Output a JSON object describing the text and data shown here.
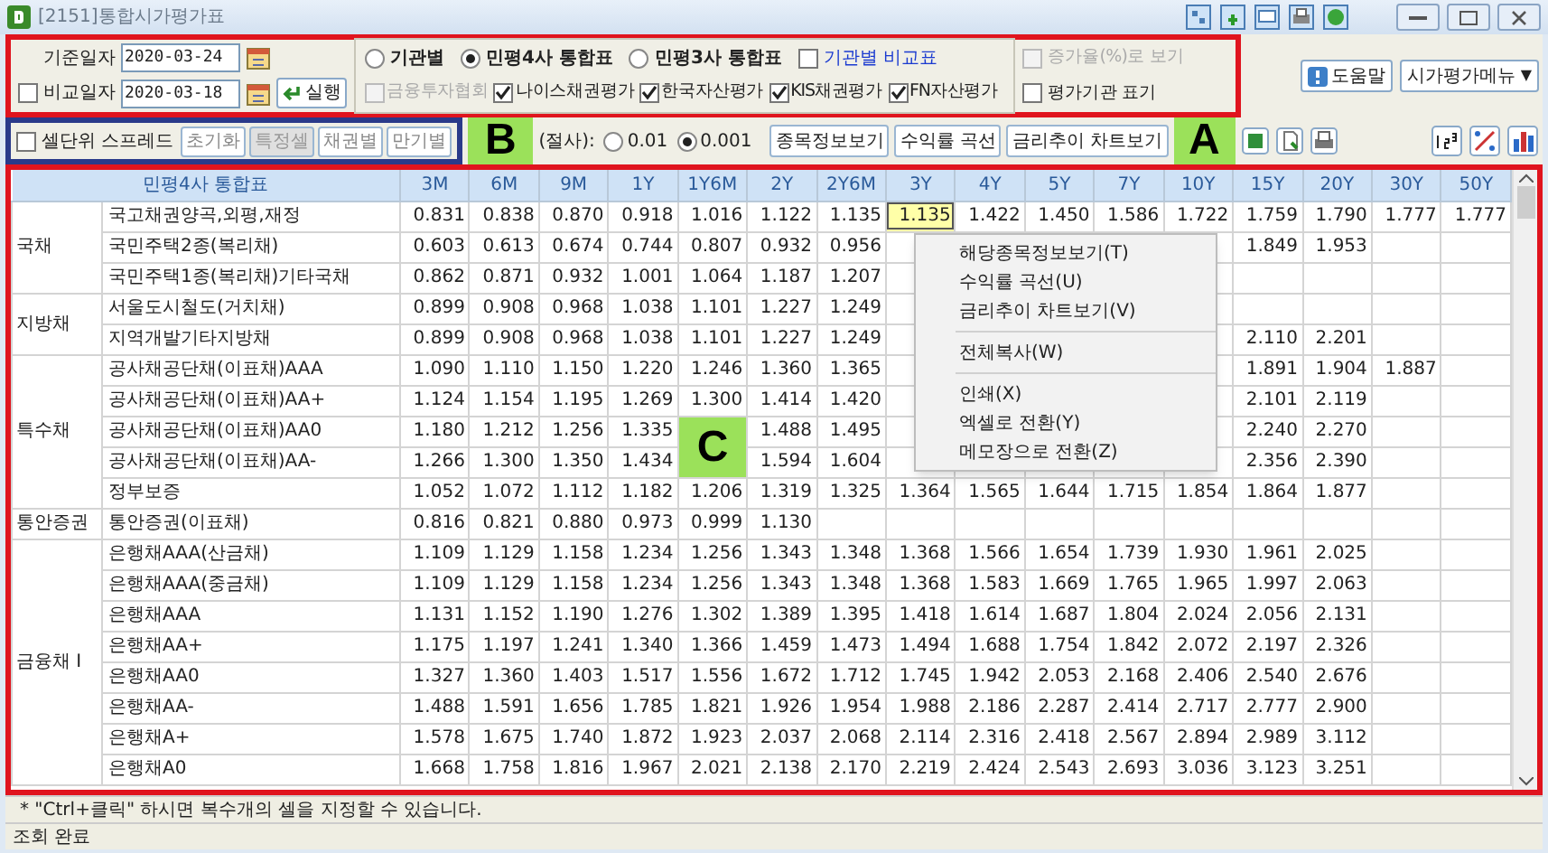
{
  "title_bar": {
    "title": "[2151]통합시가평가표"
  },
  "dates": [
    {
      "kind": "plain",
      "label": "기준일자",
      "value": "2020-03-24"
    },
    {
      "kind": "checkbox",
      "label": "비교일자",
      "value": "2020-03-18",
      "checked": false
    }
  ],
  "run_button": "실행",
  "view_radios": [
    {
      "label": "기관별",
      "selected": false
    },
    {
      "label": "민평4사 통합표",
      "selected": true
    },
    {
      "label": "민평3사 통합표",
      "selected": false
    }
  ],
  "compare_checkbox": {
    "label": "기관별 비교표",
    "checked": false
  },
  "agencies": [
    {
      "label": "금융투자협회",
      "checked": false,
      "disabled": true
    },
    {
      "label": "나이스채권평가",
      "checked": true,
      "disabled": false
    },
    {
      "label": "한국자산평가",
      "checked": true,
      "disabled": false
    },
    {
      "label": "KIS채권평가",
      "checked": true,
      "disabled": false
    },
    {
      "label": "FN자산평가",
      "checked": true,
      "disabled": false
    }
  ],
  "options": [
    {
      "label": "증가율(%)로 보기",
      "checked": false,
      "disabled": true
    },
    {
      "label": "평가기관 표기",
      "checked": false,
      "disabled": false
    }
  ],
  "help_button": "도움말",
  "menu_dropdown": {
    "label": "시가평가메뉴",
    "arrow": "▼"
  },
  "spread_checkbox": {
    "label": "셀단위 스프레드",
    "checked": false
  },
  "spread_buttons": [
    {
      "label": "초기화",
      "disabled": false
    },
    {
      "label": "특정셀",
      "disabled": true
    },
    {
      "label": "채권별",
      "disabled": false
    },
    {
      "label": "만기별",
      "disabled": false
    }
  ],
  "rounding": {
    "label": "(절사):",
    "options": [
      {
        "label": "0.01",
        "selected": false
      },
      {
        "label": "0.001",
        "selected": true
      }
    ]
  },
  "action_buttons": [
    "종목정보보기",
    "수익률 곡선",
    "금리추이 차트보기"
  ],
  "table": {
    "corner_header": "민평4사 통합표",
    "columns": [
      "3M",
      "6M",
      "9M",
      "1Y",
      "1Y6M",
      "2Y",
      "2Y6M",
      "3Y",
      "4Y",
      "5Y",
      "7Y",
      "10Y",
      "15Y",
      "20Y",
      "30Y",
      "50Y"
    ],
    "groups": [
      {
        "label": "국채",
        "rows": [
          {
            "name": "국고채권양곡,외평,재정",
            "values": [
              "0.831",
              "0.838",
              "0.870",
              "0.918",
              "1.016",
              "1.122",
              "1.135",
              {
                "text": "1.135",
                "selected": true
              },
              "1.422",
              "1.450",
              "1.586",
              "1.722",
              "1.759",
              "1.790",
              "1.777",
              "1.777"
            ]
          },
          {
            "name": "국민주택2종(복리채)",
            "values": [
              "0.603",
              "0.613",
              "0.674",
              "0.744",
              "0.807",
              "0.932",
              "0.956"
            ],
            "far_values": [
              "1.849",
              "1.953"
            ]
          },
          {
            "name": "국민주택1종(복리채)기타국채",
            "values": [
              "0.862",
              "0.871",
              "0.932",
              "1.001",
              "1.064",
              "1.187",
              "1.207"
            ]
          }
        ]
      },
      {
        "label": "지방채",
        "rows": [
          {
            "name": "서울도시철도(거치채)",
            "values": [
              "0.899",
              "0.908",
              "0.968",
              "1.038",
              "1.101",
              "1.227",
              "1.249"
            ]
          },
          {
            "name": "지역개발기타지방채",
            "values": [
              "0.899",
              "0.908",
              "0.968",
              "1.038",
              "1.101",
              "1.227",
              "1.249"
            ],
            "far_values": [
              "2.110",
              "2.201"
            ]
          }
        ]
      },
      {
        "label": "특수채",
        "rows": [
          {
            "name": "공사채공단채(이표채)AAA",
            "values": [
              "1.090",
              "1.110",
              "1.150",
              "1.220",
              "1.246",
              "1.360",
              "1.365"
            ],
            "far_values": [
              "1.891",
              "1.904",
              "1.887"
            ]
          },
          {
            "name": "공사채공단채(이표채)AA+",
            "values": [
              "1.124",
              "1.154",
              "1.195",
              "1.269",
              "1.300",
              "1.414",
              "1.420"
            ],
            "far_values": [
              "2.101",
              "2.119"
            ]
          },
          {
            "name": "공사채공단채(이표채)AA0",
            "values": [
              "1.180",
              "1.212",
              "1.256",
              "1.335"
            ],
            "mid_values": [
              "1.488",
              "1.495"
            ],
            "far_values": [
              "2.240",
              "2.270"
            ]
          },
          {
            "name": "공사채공단채(이표채)AA-",
            "values": [
              "1.266",
              "1.300",
              "1.350",
              "1.434"
            ],
            "mid_values": [
              "1.594",
              "1.604"
            ],
            "far_values": [
              "2.356",
              "2.390"
            ]
          },
          {
            "name": "정부보증",
            "values": [
              "1.052",
              "1.072",
              "1.112",
              "1.182",
              "1.206",
              "1.319",
              "1.325",
              "1.364",
              "1.565",
              "1.644",
              "1.715",
              "1.854",
              "1.864",
              "1.877"
            ]
          }
        ]
      },
      {
        "label": "통안증권",
        "rows": [
          {
            "name": "통안증권(이표채)",
            "values": [
              "0.816",
              "0.821",
              "0.880",
              "0.973",
              "0.999",
              "1.130"
            ]
          }
        ]
      },
      {
        "label": "금융채 I",
        "rows": [
          {
            "name": "은행채AAA(산금채)",
            "values": [
              "1.109",
              "1.129",
              "1.158",
              "1.234",
              "1.256",
              "1.343",
              "1.348",
              "1.368",
              "1.566",
              "1.654",
              "1.739",
              "1.930",
              "1.961",
              "2.025"
            ]
          },
          {
            "name": "은행채AAA(중금채)",
            "values": [
              "1.109",
              "1.129",
              "1.158",
              "1.234",
              "1.256",
              "1.343",
              "1.348",
              "1.368",
              "1.583",
              "1.669",
              "1.765",
              "1.965",
              "1.997",
              "2.063"
            ]
          },
          {
            "name": "은행채AAA",
            "values": [
              "1.131",
              "1.152",
              "1.190",
              "1.276",
              "1.302",
              "1.389",
              "1.395",
              "1.418",
              "1.614",
              "1.687",
              "1.804",
              "2.024",
              "2.056",
              "2.131"
            ]
          },
          {
            "name": "은행채AA+",
            "values": [
              "1.175",
              "1.197",
              "1.241",
              "1.340",
              "1.366",
              "1.459",
              "1.473",
              "1.494",
              "1.688",
              "1.754",
              "1.842",
              "2.072",
              "2.197",
              "2.326"
            ]
          },
          {
            "name": "은행채AA0",
            "values": [
              "1.327",
              "1.360",
              "1.403",
              "1.517",
              "1.556",
              "1.672",
              "1.712",
              "1.745",
              "1.942",
              "2.053",
              "2.168",
              "2.406",
              "2.540",
              "2.676"
            ]
          },
          {
            "name": "은행채AA-",
            "values": [
              "1.488",
              "1.591",
              "1.656",
              "1.785",
              "1.821",
              "1.926",
              "1.954",
              "1.988",
              "2.186",
              "2.287",
              "2.414",
              "2.717",
              "2.777",
              "2.900"
            ]
          },
          {
            "name": "은행채A+",
            "values": [
              "1.578",
              "1.675",
              "1.740",
              "1.872",
              "1.923",
              "2.037",
              "2.068",
              "2.114",
              "2.316",
              "2.418",
              "2.567",
              "2.894",
              "2.989",
              "3.112"
            ]
          },
          {
            "name": "은행채A0",
            "values": [
              "1.668",
              "1.758",
              "1.816",
              "1.967",
              "2.021",
              "2.138",
              "2.170",
              "2.219",
              "2.424",
              "2.543",
              "2.693",
              "3.036",
              "3.123",
              "3.251"
            ]
          }
        ]
      }
    ]
  },
  "context_menu": [
    {
      "kind": "item",
      "label": "해당종목정보보기(T)"
    },
    {
      "kind": "item",
      "label": "수익률 곡선(U)"
    },
    {
      "kind": "item",
      "label": "금리추이 차트보기(V)"
    },
    {
      "kind": "separator"
    },
    {
      "kind": "item",
      "label": "전체복사(W)"
    },
    {
      "kind": "separator"
    },
    {
      "kind": "item",
      "label": "인쇄(X)"
    },
    {
      "kind": "item",
      "label": "엑셀로 전환(Y)"
    },
    {
      "kind": "item",
      "label": "메모장으로 전환(Z)"
    }
  ],
  "hint": "* \"Ctrl+클릭\" 하시면 복수개의 셀을 지정할 수 있습니다.",
  "status": "조회 완료",
  "annotations": [
    {
      "label": "A"
    },
    {
      "label": "B"
    },
    {
      "label": "C"
    }
  ]
}
